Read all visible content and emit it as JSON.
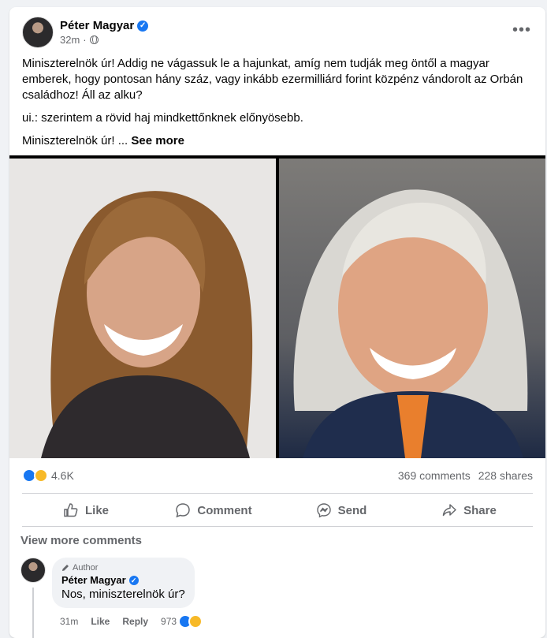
{
  "post": {
    "author": "Péter Magyar",
    "time": "32m",
    "paragraphs": [
      "Miniszterelnök úr! Addig ne vágassuk le a hajunkat, amíg nem tudják meg öntől a magyar emberek, hogy pontosan hány száz, vagy inkább ezermilliárd forint közpénz vándorolt az Orbán családhoz! Áll az alku?",
      "ui.: szerintem a rövid haj mindkettőnknek előnyösebb.",
      "Miniszterelnök úr! ..."
    ],
    "see_more": "See more",
    "icons": {
      "verified": "verified-badge-icon",
      "audience": "globe-icon",
      "menu": "more-options-icon"
    }
  },
  "stats": {
    "reactions": "4.6K",
    "comments": "369 comments",
    "shares": "228 shares"
  },
  "actions": {
    "like": "Like",
    "comment": "Comment",
    "send": "Send",
    "share": "Share"
  },
  "comments": {
    "view_more": "View more comments",
    "items": [
      {
        "tag": "Author",
        "author": "Péter Magyar",
        "text": "Nos, miniszterelnök úr?",
        "time": "31m",
        "like": "Like",
        "reply": "Reply",
        "reactions": "973"
      }
    ]
  },
  "colors": {
    "accent": "#1877f2",
    "muted": "#65676b",
    "haha": "#f7b928"
  }
}
